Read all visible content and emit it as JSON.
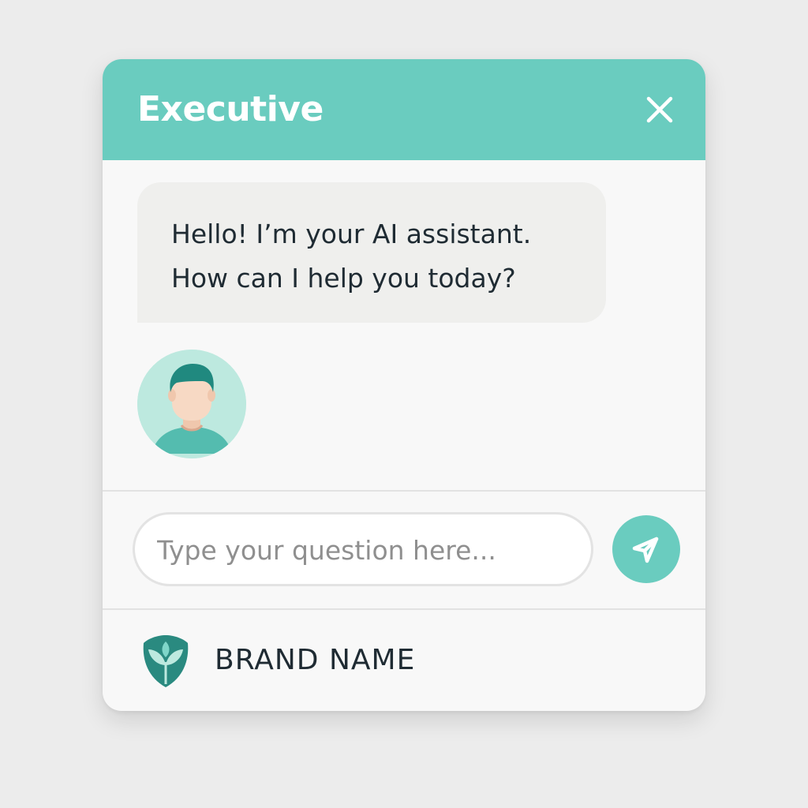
{
  "header": {
    "title": "Executive",
    "close_icon": "close-icon"
  },
  "messages": [
    {
      "sender": "assistant",
      "lines": [
        "Hello! I’m your AI assistant.",
        "How can I help you today?"
      ]
    }
  ],
  "user": {
    "avatar_icon": "user-avatar-icon"
  },
  "composer": {
    "placeholder": "Type your question here...",
    "value": "",
    "send_icon": "send-icon"
  },
  "footer": {
    "brand_name": "BRAND NAME",
    "logo_icon": "leaf-shield-logo-icon"
  },
  "colors": {
    "accent": "#6accbf",
    "accent_dark": "#2a8a80",
    "background": "#ececec",
    "panel": "#f8f8f8",
    "bubble": "#efefed",
    "text": "#1f2b33",
    "placeholder": "#8f8f8f"
  }
}
